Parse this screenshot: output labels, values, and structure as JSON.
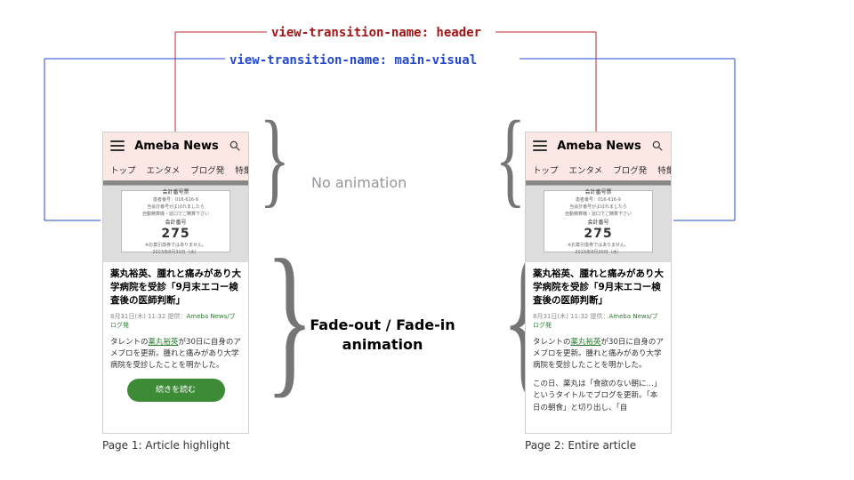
{
  "props": {
    "header": "view-transition-name: header",
    "visual": "view-transition-name: main-visual"
  },
  "labels": {
    "no_anim": "No animation",
    "fade": "Fade-out / Fade-in animation"
  },
  "captions": {
    "page1": "Page 1: Article highlight",
    "page2": "Page 2: Entire article"
  },
  "app": {
    "logo": "Ameba News",
    "nav": [
      "トップ",
      "エンタメ",
      "ブログ発",
      "特集"
    ]
  },
  "ticket": {
    "title": "会計番号票",
    "line1": "患者番号：016-616-9",
    "line2": "当会計番号がよばれましたら",
    "line3": "自動精算機・窓口でご精算下さい",
    "label": "会計番号",
    "number": "275",
    "foot": "※お薬引換券ではありません。",
    "date": "2023年8月30日（水）"
  },
  "article": {
    "headline": "薬丸裕英、腫れと痛みがあり大学病院を受診「9月末エコー検査後の医師判断」",
    "date": "8月31日(木) 11:32",
    "provider_label": "提供：",
    "provider": "Ameba News/ブログ発",
    "excerpt_pre": "タレントの",
    "excerpt_hl": "薬丸裕英",
    "excerpt_post": "が30日に自身のアメブロを更新。腫れと痛みがあり大学病院を受診したことを明かした。",
    "cta": "続きを読む",
    "para2": "この日、薬丸は「食欲のない朝に…」というタイトルでブログを更新。「本日の朝食」と切り出し、「自"
  }
}
